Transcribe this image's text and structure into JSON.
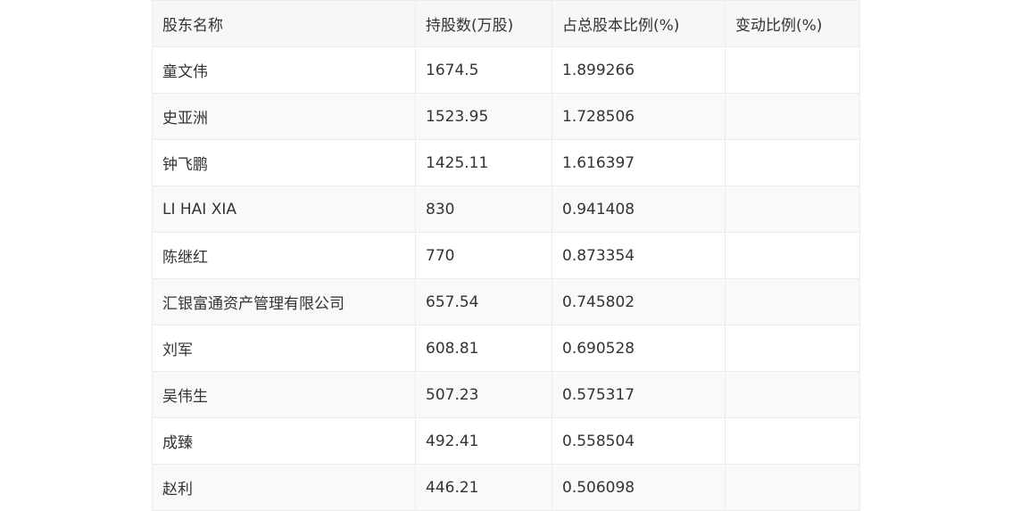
{
  "table": {
    "headers": [
      "股东名称",
      "持股数(万股)",
      "占总股本比例(%)",
      "变动比例(%)"
    ],
    "rows": [
      [
        "童文伟",
        "1674.5",
        "1.899266",
        ""
      ],
      [
        "史亚洲",
        "1523.95",
        "1.728506",
        ""
      ],
      [
        "钟飞鹏",
        "1425.11",
        "1.616397",
        ""
      ],
      [
        "LI HAI XIA",
        "830",
        "0.941408",
        ""
      ],
      [
        "陈继红",
        "770",
        "0.873354",
        ""
      ],
      [
        "汇银富通资产管理有限公司",
        "657.54",
        "0.745802",
        ""
      ],
      [
        "刘军",
        "608.81",
        "0.690528",
        ""
      ],
      [
        "吴伟生",
        "507.23",
        "0.575317",
        ""
      ],
      [
        "成臻",
        "492.41",
        "0.558504",
        ""
      ],
      [
        "赵利",
        "446.21",
        "0.506098",
        ""
      ]
    ]
  }
}
